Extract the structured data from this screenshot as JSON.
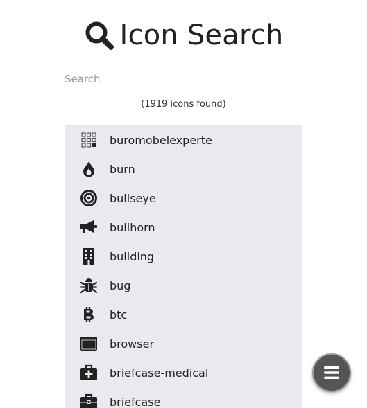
{
  "header": {
    "title": "Icon Search",
    "icon": "search-icon"
  },
  "search": {
    "placeholder": "Search",
    "value": ""
  },
  "results": {
    "count_text": "(1919 icons found)"
  },
  "icons": [
    {
      "name": "buromobelexperte",
      "icon": "buromobelexperte-icon"
    },
    {
      "name": "burn",
      "icon": "burn-icon"
    },
    {
      "name": "bullseye",
      "icon": "bullseye-icon"
    },
    {
      "name": "bullhorn",
      "icon": "bullhorn-icon"
    },
    {
      "name": "building",
      "icon": "building-icon"
    },
    {
      "name": "bug",
      "icon": "bug-icon"
    },
    {
      "name": "btc",
      "icon": "btc-icon"
    },
    {
      "name": "browser",
      "icon": "browser-icon"
    },
    {
      "name": "briefcase-medical",
      "icon": "briefcase-medical-icon"
    },
    {
      "name": "briefcase",
      "icon": "briefcase-icon"
    }
  ],
  "fab": {
    "icon": "menu-icon"
  },
  "colors": {
    "list_bg": "#e8eaef",
    "icon": "#222222",
    "fab": "#555555"
  }
}
